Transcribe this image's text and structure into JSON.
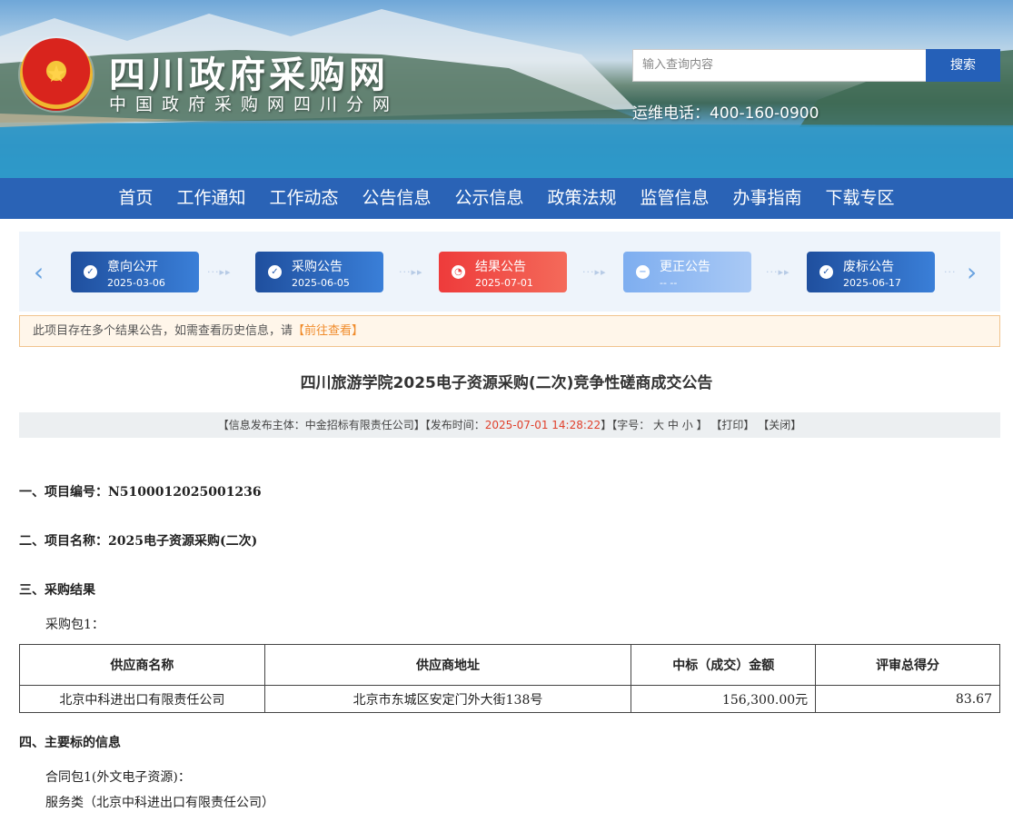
{
  "header": {
    "emblem_glyph": "★",
    "site_title": "四川政府采购网",
    "site_subtitle": "中国政府采购网四川分网",
    "search_placeholder": "输入查询内容",
    "search_button": "搜索",
    "hotline": "运维电话：400-160-0900"
  },
  "nav": {
    "items": [
      "首页",
      "工作通知",
      "工作动态",
      "公告信息",
      "公示信息",
      "政策法规",
      "监管信息",
      "办事指南",
      "下载专区"
    ]
  },
  "timeline": {
    "prev_icon": "chevron-left-icon",
    "next_icon": "chevron-right-icon",
    "steps": [
      {
        "label": "意向公开",
        "date": "2025-03-06",
        "status": "done",
        "icon": "check-circle-icon"
      },
      {
        "label": "采购公告",
        "date": "2025-06-05",
        "status": "done",
        "icon": "check-circle-icon"
      },
      {
        "label": "结果公告",
        "date": "2025-07-01",
        "status": "current",
        "icon": "clock-icon"
      },
      {
        "label": "更正公告",
        "date": "-- --",
        "status": "none",
        "icon": "minus-circle-icon"
      },
      {
        "label": "废标公告",
        "date": "2025-06-17",
        "status": "done",
        "icon": "check-circle-icon"
      }
    ],
    "colors": {
      "done": "#2a5fb0",
      "current": "#ee3b3b",
      "none": "#8ab5f0"
    }
  },
  "notice": {
    "text": "此项目存在多个结果公告，如需查看历史信息，请",
    "link": "【前往查看】"
  },
  "document": {
    "title": "四川旅游学院2025电子资源采购(二次)竞争性磋商成交公告",
    "meta": {
      "publisher_label": "【信息发布主体：中金招标有限责任公司】【发布时间：",
      "publish_time": "2025-07-01 14:28:22",
      "font_label": "】【字号：",
      "size_large": "大",
      "size_medium": "中",
      "size_small": "小",
      "font_end": "】",
      "print": "【打印】",
      "close": "【关闭】"
    },
    "sections": {
      "s1": "一、项目编号：N5100012025001236",
      "s2": "二、项目名称：2025电子资源采购(二次)",
      "s3": "三、采购结果",
      "s3_package": "采购包1：",
      "s4": "四、主要标的信息",
      "s4_contract": "合同包1(外文电子资源)：",
      "s4_service": "服务类（北京中科进出口有限责任公司）"
    },
    "result_table": {
      "headers": [
        "供应商名称",
        "供应商地址",
        "中标（成交）金额",
        "评审总得分"
      ],
      "rows": [
        [
          "北京中科进出口有限责任公司",
          "北京市东城区安定门外大街138号",
          "156,300.00元",
          "83.67"
        ]
      ]
    }
  }
}
